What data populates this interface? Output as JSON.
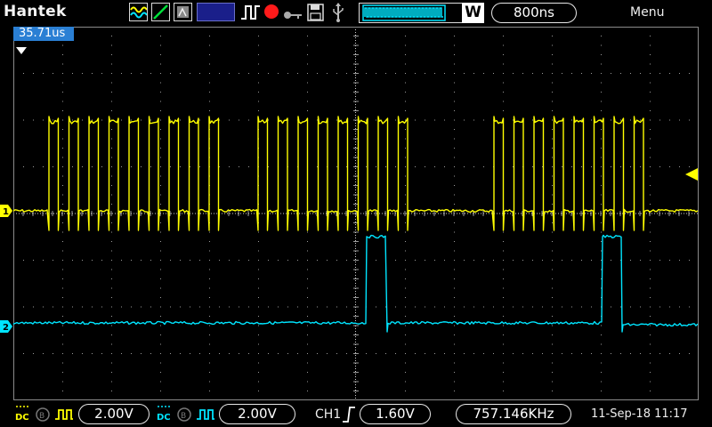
{
  "app": {
    "brand": "Hantek"
  },
  "toolbar": {
    "icons": [
      "waveform-icon",
      "cursor-line-icon",
      "persist-icon",
      "run-stop-icon",
      "record-icon",
      "key-icon",
      "save-icon",
      "usb-icon"
    ]
  },
  "timebase": {
    "value": "800ns",
    "window_letter": "W"
  },
  "menu": {
    "label": "Menu"
  },
  "trigger": {
    "offset_time": "35.71us",
    "source": "CH1",
    "level": "1.60V"
  },
  "channels": [
    {
      "id": "1",
      "color": "#ffff00",
      "volts_div": "2.00V",
      "coupling": "DC"
    },
    {
      "id": "2",
      "color": "#00e5ff",
      "volts_div": "2.00V",
      "coupling": "DC"
    }
  ],
  "measurement": {
    "frequency": "757.146KHz"
  },
  "status": {
    "datetime": "11-Sep-18 11:17"
  },
  "colors": {
    "grid": "#9a9a9a",
    "brand": "#ffffff",
    "accent": "#2a7fd4"
  }
}
